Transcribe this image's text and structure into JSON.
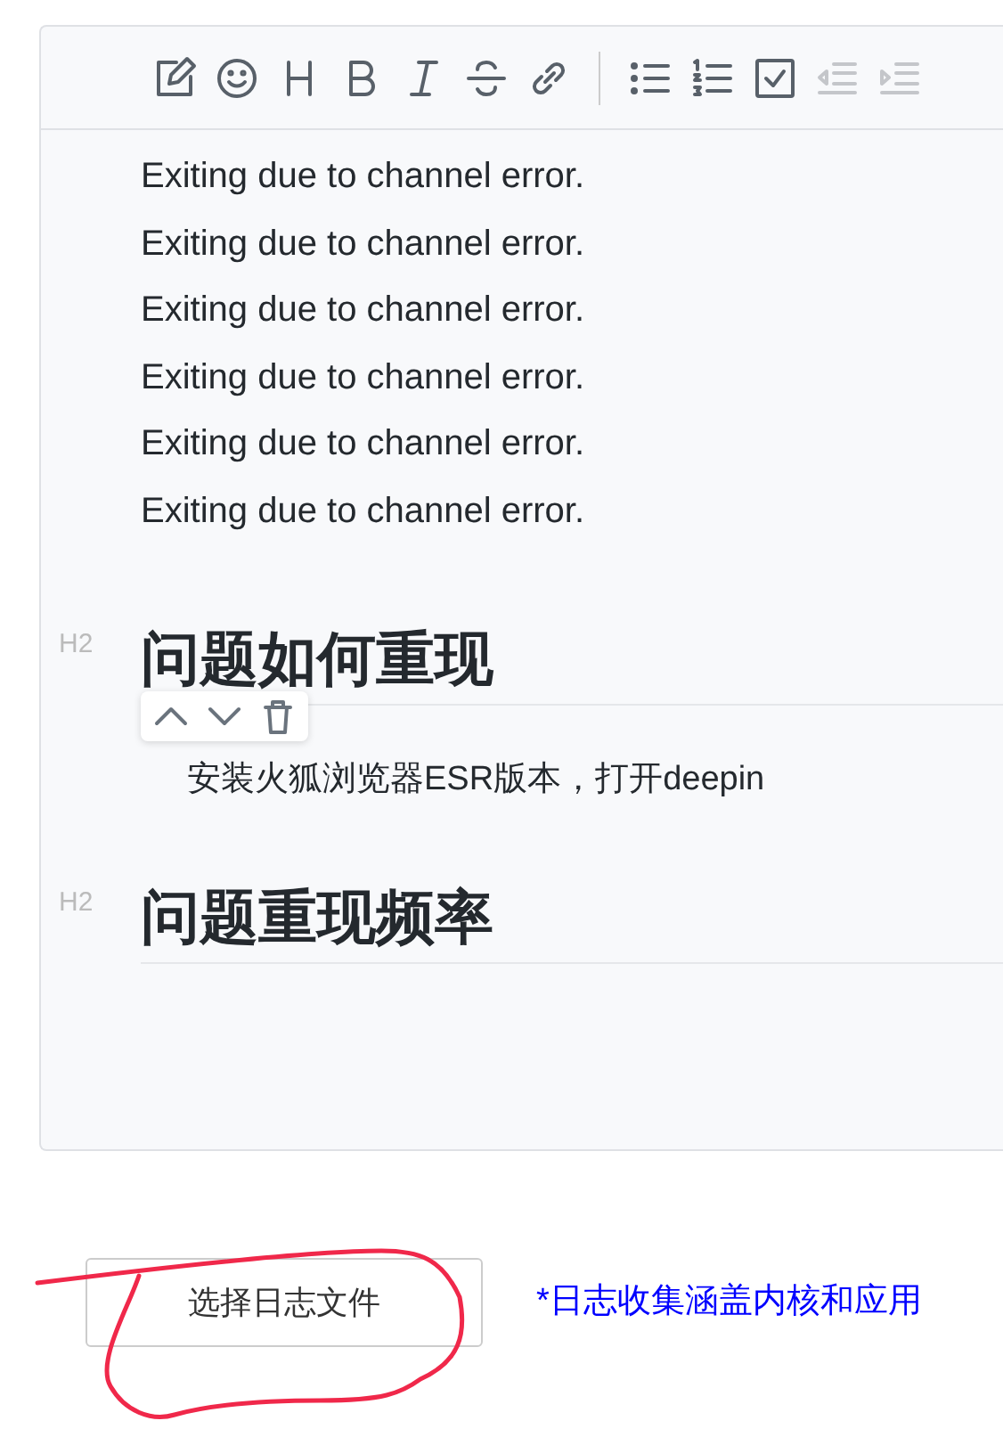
{
  "editor": {
    "toolbar": [
      {
        "kind": "edit",
        "disabled": false
      },
      {
        "kind": "emoji",
        "disabled": false
      },
      {
        "kind": "heading",
        "disabled": false
      },
      {
        "kind": "bold",
        "disabled": false
      },
      {
        "kind": "italic",
        "disabled": false
      },
      {
        "kind": "strike",
        "disabled": false
      },
      {
        "kind": "link",
        "disabled": false
      },
      {
        "kind": "separator"
      },
      {
        "kind": "bullet-list",
        "disabled": false
      },
      {
        "kind": "ordered-list",
        "disabled": false
      },
      {
        "kind": "check",
        "disabled": false
      },
      {
        "kind": "outdent",
        "disabled": true
      },
      {
        "kind": "indent",
        "disabled": true
      }
    ],
    "blocks": [
      {
        "kind": "line",
        "text": "Exiting due to channel error."
      },
      {
        "kind": "line",
        "text": "Exiting due to channel error."
      },
      {
        "kind": "line",
        "text": "Exiting due to channel error."
      },
      {
        "kind": "line",
        "text": "Exiting due to channel error."
      },
      {
        "kind": "line",
        "text": "Exiting due to channel error."
      },
      {
        "kind": "line",
        "text": "Exiting due to channel error."
      },
      {
        "kind": "heading",
        "marker": "H2",
        "text": "问题如何重现"
      },
      {
        "kind": "block-tools"
      },
      {
        "kind": "paragraph",
        "text": "安装火狐浏览器ESR版本，打开deepin"
      },
      {
        "kind": "heading",
        "marker": "H2",
        "text": "问题重现频率"
      }
    ]
  },
  "upload": {
    "button": "选择日志文件",
    "note": "*日志收集涵盖内核和应用"
  }
}
